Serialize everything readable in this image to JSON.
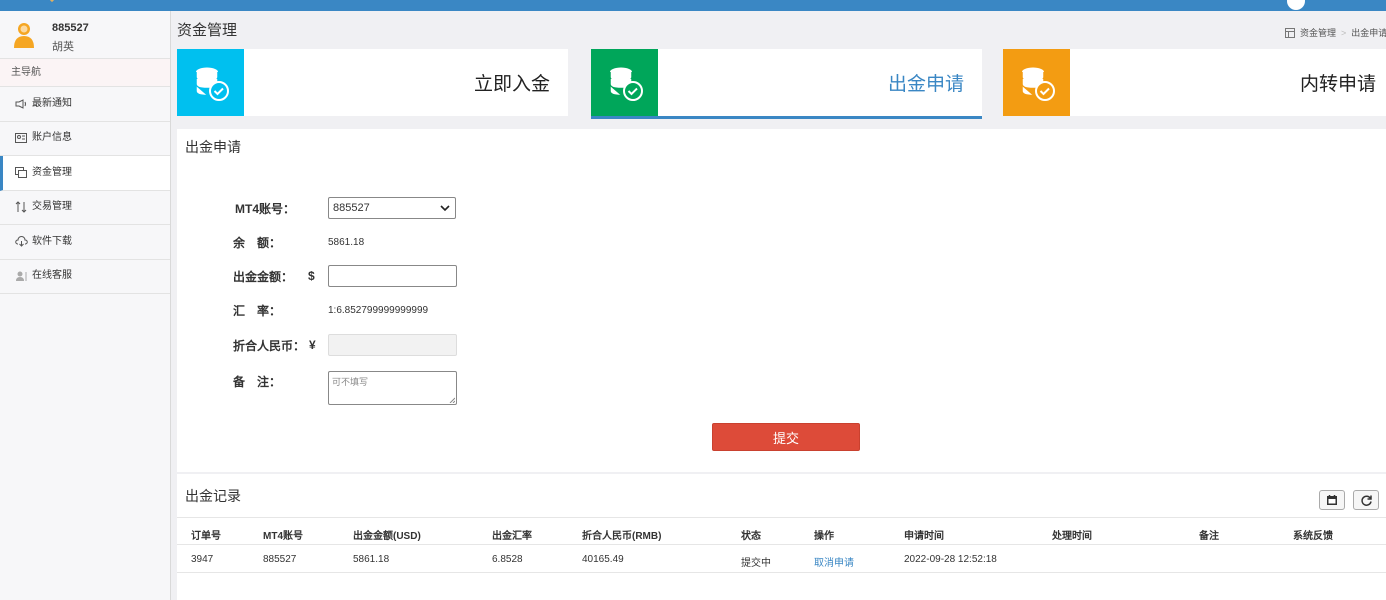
{
  "user": {
    "id": "885527",
    "name": "胡英"
  },
  "nav": {
    "header": "主导航",
    "items": [
      {
        "label": "最新通知",
        "icon": "speaker-icon"
      },
      {
        "label": "账户信息",
        "icon": "id-card-icon"
      },
      {
        "label": "资金管理",
        "icon": "money-icon"
      },
      {
        "label": "交易管理",
        "icon": "exchange-icon"
      },
      {
        "label": "软件下载",
        "icon": "cloud-download-icon"
      },
      {
        "label": "在线客服",
        "icon": "user-icon"
      }
    ]
  },
  "page": {
    "title": "资金管理",
    "breadcrumb": [
      "资金管理",
      "出金申请"
    ]
  },
  "cards": [
    {
      "label": "立即入金",
      "color": "#00c0ef"
    },
    {
      "label": "出金申请",
      "color": "#00a65a"
    },
    {
      "label": "内转申请",
      "color": "#f39c12"
    }
  ],
  "form": {
    "title": "出金申请",
    "mt4_label": "MT4账号：",
    "mt4_value": "885527",
    "balance_label": "余　额：",
    "balance_value": "5861.18",
    "amount_label": "出金金额：",
    "amount_currency": "$",
    "amount_value": "",
    "rate_label": "汇　率：",
    "rate_value": "1:6.852799999999999",
    "rmb_label": "折合人民币：",
    "rmb_currency": "¥",
    "rmb_value": "",
    "note_label": "备　注：",
    "note_placeholder": "可不填写",
    "submit_label": "提交"
  },
  "records": {
    "title": "出金记录",
    "columns": [
      "订单号",
      "MT4账号",
      "出金金额(USD)",
      "出金汇率",
      "折合人民币(RMB)",
      "状态",
      "操作",
      "申请时间",
      "处理时间",
      "备注",
      "系统反馈"
    ],
    "rows": [
      [
        "3947",
        "885527",
        "5861.18",
        "6.8528",
        "40165.49",
        "提交中",
        "取消申请",
        "2022-09-28 12:52:18",
        "",
        "",
        ""
      ]
    ]
  }
}
